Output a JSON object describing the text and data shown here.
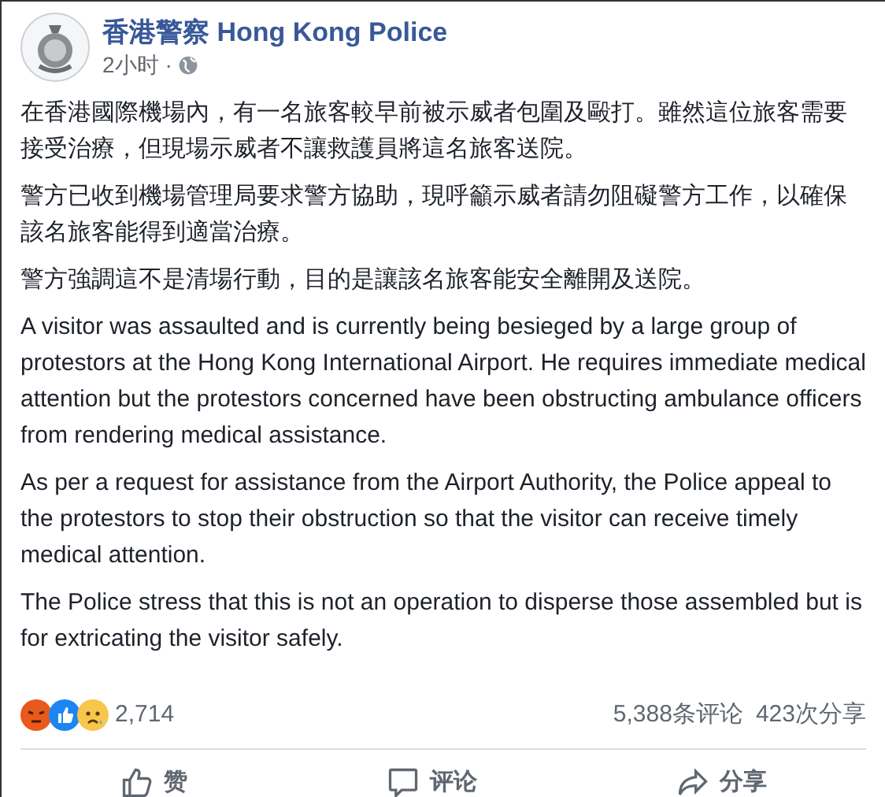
{
  "post": {
    "author": "香港警察 Hong Kong Police",
    "time": "2小时",
    "separator": "·",
    "paragraphs": [
      "在香港國際機場內，有一名旅客較早前被示威者包圍及毆打。雖然這位旅客需要接受治療，但現場示威者不讓救護員將這名旅客送院。",
      "警方已收到機場管理局要求警方協助，現呼籲示威者請勿阻礙警方工作，以確保該名旅客能得到適當治療。",
      "警方強調這不是清場行動，目的是讓該名旅客能安全離開及送院。",
      "A visitor was assaulted and is currently being besieged by a large group of protestors at the Hong Kong International Airport. He requires immediate medical attention but the protestors concerned have been obstructing ambulance officers from rendering medical assistance.",
      "As per a request for assistance from the Airport Authority, the Police appeal to the protestors to stop their obstruction so that the visitor can receive timely medical attention.",
      "The Police stress that this is not an operation to disperse those assembled but is for extricating the visitor safely."
    ],
    "reaction_count": "2,714",
    "comments": "5,388条评论",
    "shares": "423次分享",
    "actions": [
      {
        "kind": "like",
        "label": "赞"
      },
      {
        "kind": "comment",
        "label": "评论"
      },
      {
        "kind": "share",
        "label": "分享"
      }
    ]
  }
}
